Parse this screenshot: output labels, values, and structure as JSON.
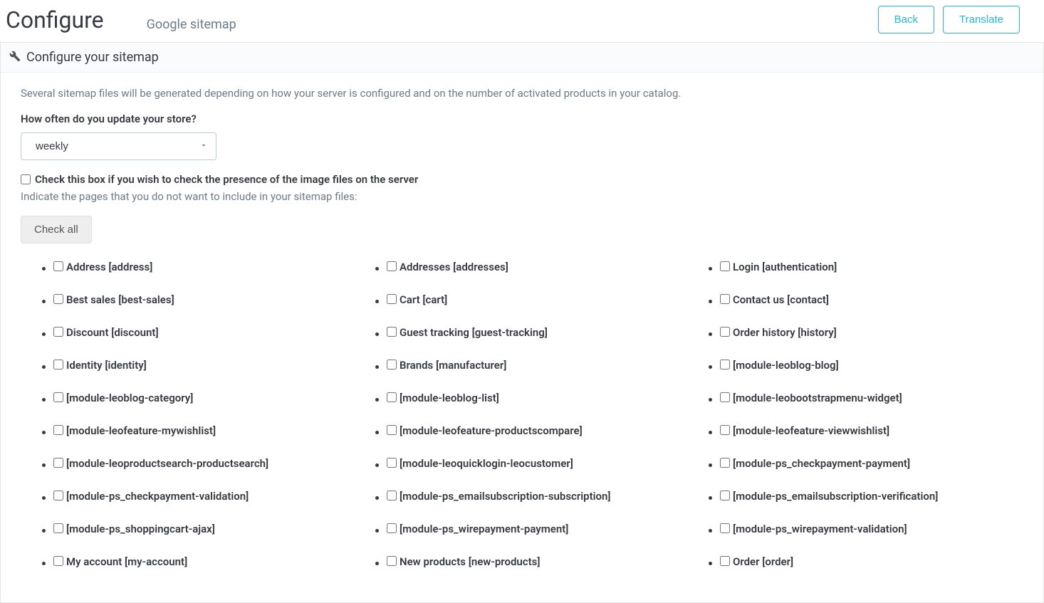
{
  "header": {
    "title": "Configure",
    "subtitle": "Google sitemap",
    "back_label": "Back",
    "translate_label": "Translate"
  },
  "panel": {
    "heading": "Configure your sitemap",
    "description": "Several sitemap files will be generated depending on how your server is configured and on the number of activated products in your catalog.",
    "frequency_label": "How often do you update your store?",
    "frequency_value": "weekly",
    "check_images_label": "Check this box if you wish to check the presence of the image files on the server",
    "exclude_hint": "Indicate the pages that you do not want to include in your sitemap files:",
    "check_all_label": "Check all"
  },
  "pages": [
    {
      "label": "Address [address]"
    },
    {
      "label": "Addresses [addresses]"
    },
    {
      "label": "Login [authentication]"
    },
    {
      "label": "Best sales [best-sales]"
    },
    {
      "label": "Cart [cart]"
    },
    {
      "label": "Contact us [contact]"
    },
    {
      "label": "Discount [discount]"
    },
    {
      "label": "Guest tracking [guest-tracking]"
    },
    {
      "label": "Order history [history]"
    },
    {
      "label": "Identity [identity]"
    },
    {
      "label": "Brands [manufacturer]"
    },
    {
      "label": "[module-leoblog-blog]"
    },
    {
      "label": "[module-leoblog-category]"
    },
    {
      "label": "[module-leoblog-list]"
    },
    {
      "label": "[module-leobootstrapmenu-widget]"
    },
    {
      "label": "[module-leofeature-mywishlist]"
    },
    {
      "label": "[module-leofeature-productscompare]"
    },
    {
      "label": "[module-leofeature-viewwishlist]"
    },
    {
      "label": "[module-leoproductsearch-productsearch]"
    },
    {
      "label": "[module-leoquicklogin-leocustomer]"
    },
    {
      "label": "[module-ps_checkpayment-payment]"
    },
    {
      "label": "[module-ps_checkpayment-validation]"
    },
    {
      "label": "[module-ps_emailsubscription-subscription]"
    },
    {
      "label": "[module-ps_emailsubscription-verification]"
    },
    {
      "label": "[module-ps_shoppingcart-ajax]"
    },
    {
      "label": "[module-ps_wirepayment-payment]"
    },
    {
      "label": "[module-ps_wirepayment-validation]"
    },
    {
      "label": "My account [my-account]"
    },
    {
      "label": "New products [new-products]"
    },
    {
      "label": "Order [order]"
    }
  ]
}
